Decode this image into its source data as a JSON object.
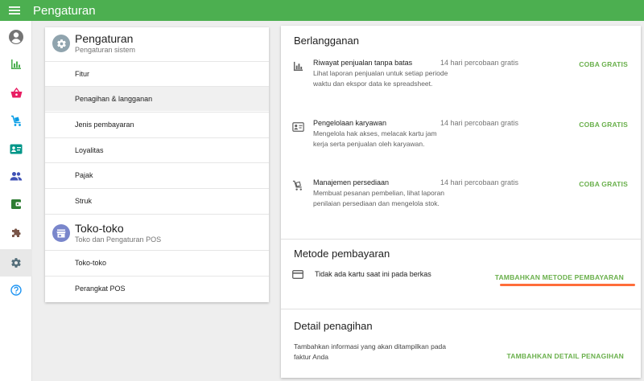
{
  "topbar": {
    "title": "Pengaturan",
    "menu_icon": "menu-icon"
  },
  "rail": {
    "items": [
      {
        "name": "account",
        "icon": "account-circle-icon",
        "color": "#757575"
      },
      {
        "name": "reports",
        "icon": "bar-chart-icon",
        "color": "#4caf50"
      },
      {
        "name": "sales",
        "icon": "basket-icon",
        "color": "#e91e63"
      },
      {
        "name": "inventory",
        "icon": "cart-icon",
        "color": "#039be5"
      },
      {
        "name": "employees",
        "icon": "badge-icon",
        "color": "#009688"
      },
      {
        "name": "customers",
        "icon": "people-icon",
        "color": "#3f51b5"
      },
      {
        "name": "integrations",
        "icon": "wallet-icon",
        "color": "#2e7d32"
      },
      {
        "name": "apps",
        "icon": "puzzle-icon",
        "color": "#795548"
      },
      {
        "name": "settings",
        "icon": "gear-icon",
        "color": "#546e7a"
      },
      {
        "name": "help",
        "icon": "help-icon",
        "color": "#2196f3"
      }
    ]
  },
  "left": {
    "settings_section": {
      "title": "Pengaturan",
      "subtitle": "Pengaturan sistem",
      "icon": "gear-icon",
      "color": "#90a4ae"
    },
    "settings_items": [
      "Fitur",
      "Penagihan & langganan",
      "Jenis pembayaran",
      "Loyalitas",
      "Pajak",
      "Struk"
    ],
    "stores_section": {
      "title": "Toko-toko",
      "subtitle": "Toko dan Pengaturan POS",
      "icon": "store-icon",
      "color": "#7986cb"
    },
    "stores_items": [
      "Toko-toko",
      "Perangkat POS"
    ]
  },
  "subscriptions": {
    "title": "Berlangganan",
    "items": [
      {
        "title": "Riwayat penjualan tanpa batas",
        "desc": "Lihat laporan penjualan untuk setiap periode waktu dan ekspor data ke spreadsheet.",
        "trial": "14 hari percobaan gratis",
        "action": "COBA GRATIS",
        "icon": "bar-chart-icon"
      },
      {
        "title": "Pengelolaan karyawan",
        "desc": "Mengelola hak akses, melacak kartu jam kerja serta penjualan oleh karyawan.",
        "trial": "14 hari percobaan gratis",
        "action": "COBA GRATIS",
        "icon": "badge-icon"
      },
      {
        "title": "Manajemen persediaan",
        "desc": "Membuat pesanan pembelian, lihat laporan penilaian persediaan dan mengelola stok.",
        "trial": "14 hari percobaan gratis",
        "action": "COBA GRATIS",
        "icon": "cart-icon"
      }
    ]
  },
  "payment": {
    "title": "Metode pembayaran",
    "no_card": "Tidak ada kartu saat ini pada berkas",
    "action": "TAMBAHKAN METODE PEMBAYARAN",
    "icon": "credit-card-icon"
  },
  "billing": {
    "title": "Detail penagihan",
    "desc": "Tambahkan informasi yang akan ditampilkan pada faktur Anda",
    "action": "TAMBAHKAN DETAIL PENAGIHAN"
  },
  "colors": {
    "brand": "#4caf50",
    "action": "#6ab04c",
    "highlight": "#ff6d3a"
  }
}
